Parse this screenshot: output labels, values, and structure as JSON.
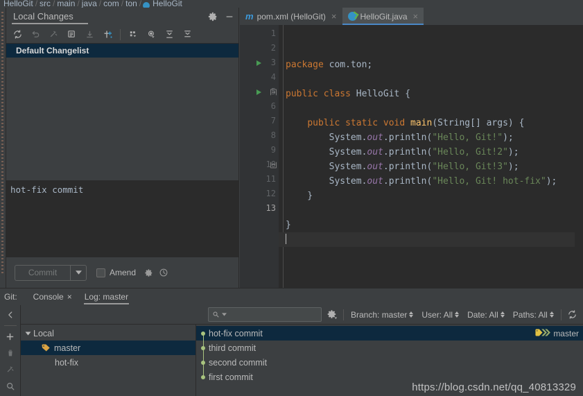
{
  "breadcrumb": {
    "items": [
      "HelloGit",
      "src",
      "main",
      "java",
      "com",
      "ton",
      "HelloGit"
    ],
    "separator": "/"
  },
  "local_changes": {
    "title": "Local Changes",
    "settings_icon": "gear-icon",
    "minimize_icon": "minimize-icon",
    "toolbar": [
      {
        "name": "refresh-icon",
        "label": "Refresh"
      },
      {
        "name": "rollback-icon",
        "label": "Rollback"
      },
      {
        "name": "shelve-icon",
        "label": "Shelve Silently"
      },
      {
        "name": "diff-icon",
        "label": "Show Diff"
      },
      {
        "name": "update-icon",
        "label": "Update"
      },
      {
        "name": "move-to-changelist-icon",
        "label": "Move to Another Changelist"
      },
      {
        "name": "group-by-icon",
        "label": "Group By"
      },
      {
        "name": "preview-icon",
        "label": "Preview Diff"
      },
      {
        "name": "expand-all-icon",
        "label": "Expand All"
      },
      {
        "name": "collapse-all-icon",
        "label": "Collapse All"
      }
    ],
    "changelist": "Default Changelist",
    "commit_message": "hot-fix commit",
    "commit_button": "Commit",
    "commit_dropdown_icon": "chevron-down-icon",
    "amend_label": "Amend",
    "amend_checked": false,
    "settings_button_icon": "gear-icon",
    "history_button_icon": "clock-icon"
  },
  "editor": {
    "tabs": [
      {
        "label": "pom.xml (HelloGit)",
        "icon": "maven-icon",
        "active": false,
        "close": "×"
      },
      {
        "label": "HelloGit.java",
        "icon": "java-class-icon",
        "active": true,
        "close": "×"
      }
    ],
    "gutter_lines": [
      "1",
      "2",
      "3",
      "4",
      "5",
      "6",
      "7",
      "8",
      "9",
      "10",
      "11",
      "12",
      "13"
    ],
    "current_line": "13",
    "run_markers": [
      "3",
      "5"
    ],
    "code_lines": [
      {
        "n": "1",
        "tokens": [
          {
            "t": "kw",
            "v": "package "
          },
          {
            "t": "pln",
            "v": "com.ton;"
          }
        ],
        "indent": 0
      },
      {
        "n": "2",
        "tokens": [],
        "indent": 0
      },
      {
        "n": "3",
        "tokens": [
          {
            "t": "kw",
            "v": "public class "
          },
          {
            "t": "cls",
            "v": "HelloGit "
          },
          {
            "t": "pln",
            "v": "{"
          }
        ],
        "indent": 0
      },
      {
        "n": "4",
        "tokens": [],
        "indent": 1
      },
      {
        "n": "5",
        "tokens": [
          {
            "t": "pln",
            "v": "    "
          },
          {
            "t": "kw",
            "v": "public static void "
          },
          {
            "t": "fn",
            "v": "main"
          },
          {
            "t": "pln",
            "v": "(String[] args) {"
          }
        ],
        "indent": 1
      },
      {
        "n": "6",
        "tokens": [
          {
            "t": "pln",
            "v": "        System."
          },
          {
            "t": "fld",
            "v": "out"
          },
          {
            "t": "pln",
            "v": ".println("
          },
          {
            "t": "str",
            "v": "\"Hello, Git!\""
          },
          {
            "t": "pln",
            "v": ");"
          }
        ],
        "indent": 1
      },
      {
        "n": "7",
        "tokens": [
          {
            "t": "pln",
            "v": "        System."
          },
          {
            "t": "fld",
            "v": "out"
          },
          {
            "t": "pln",
            "v": ".println("
          },
          {
            "t": "str",
            "v": "\"Hello, Git!2\""
          },
          {
            "t": "pln",
            "v": ");"
          }
        ],
        "indent": 1
      },
      {
        "n": "8",
        "tokens": [
          {
            "t": "pln",
            "v": "        System."
          },
          {
            "t": "fld",
            "v": "out"
          },
          {
            "t": "pln",
            "v": ".println("
          },
          {
            "t": "str",
            "v": "\"Hello, Git!3\""
          },
          {
            "t": "pln",
            "v": ");"
          }
        ],
        "indent": 1
      },
      {
        "n": "9",
        "tokens": [
          {
            "t": "pln",
            "v": "        System."
          },
          {
            "t": "fld",
            "v": "out"
          },
          {
            "t": "pln",
            "v": ".println("
          },
          {
            "t": "str",
            "v": "\"Hello, Git! hot-fix\""
          },
          {
            "t": "pln",
            "v": ");"
          }
        ],
        "indent": 1
      },
      {
        "n": "10",
        "tokens": [
          {
            "t": "pln",
            "v": "    }"
          }
        ],
        "indent": 1
      },
      {
        "n": "11",
        "tokens": [],
        "indent": 0
      },
      {
        "n": "12",
        "tokens": [
          {
            "t": "pln",
            "v": "}"
          }
        ],
        "indent": 0
      },
      {
        "n": "13",
        "tokens": [],
        "indent": 0
      }
    ]
  },
  "git_window": {
    "label": "Git:",
    "tabs": [
      {
        "label": "Console",
        "active": false,
        "close": "×"
      },
      {
        "label": "Log: master",
        "active": true,
        "close": ""
      }
    ],
    "vertical_tools": [
      {
        "name": "collapse-left-icon",
        "label": "Hide"
      },
      {
        "name": "add-icon",
        "label": "Add"
      },
      {
        "name": "delete-icon",
        "label": "Delete"
      },
      {
        "name": "collapse-icon",
        "label": "Collapse"
      },
      {
        "name": "search-icon",
        "label": "Find"
      }
    ],
    "log_toolbar": {
      "search_placeholder": "",
      "search_icon": "search-icon",
      "settings_icon": "gear-icon",
      "filters": [
        {
          "name": "branch-filter",
          "label": "Branch: master"
        },
        {
          "name": "user-filter",
          "label": "User: All"
        },
        {
          "name": "date-filter",
          "label": "Date: All"
        },
        {
          "name": "paths-filter",
          "label": "Paths: All"
        }
      ],
      "refresh_icon": "refresh-icon"
    },
    "branch_tree": {
      "root": "Local",
      "branches": [
        {
          "label": "master",
          "selected": true,
          "has_tag_icon": true
        },
        {
          "label": "hot-fix",
          "selected": false,
          "has_tag_icon": false
        }
      ]
    },
    "commits": [
      {
        "subject": "hot-fix commit",
        "selected": true,
        "ref": "master",
        "ref_icon": "branch-label-icon"
      },
      {
        "subject": "third commit",
        "selected": false,
        "ref": "",
        "ref_icon": ""
      },
      {
        "subject": "second commit",
        "selected": false,
        "ref": "",
        "ref_icon": ""
      },
      {
        "subject": "first commit",
        "selected": false,
        "ref": "",
        "ref_icon": ""
      }
    ]
  },
  "watermark": "https://blog.csdn.net/qq_40813329",
  "colors": {
    "panel_bg": "#3c3f41",
    "editor_bg": "#2b2b2b",
    "gutter_bg": "#313335",
    "selection_bg": "#0d293e",
    "accent_blue": "#4a88c7",
    "graph_green": "#a9c47f",
    "keyword_orange": "#cc7832",
    "string_green": "#6a8759",
    "field_purple": "#9876aa",
    "method_yellow": "#ffc66d"
  }
}
